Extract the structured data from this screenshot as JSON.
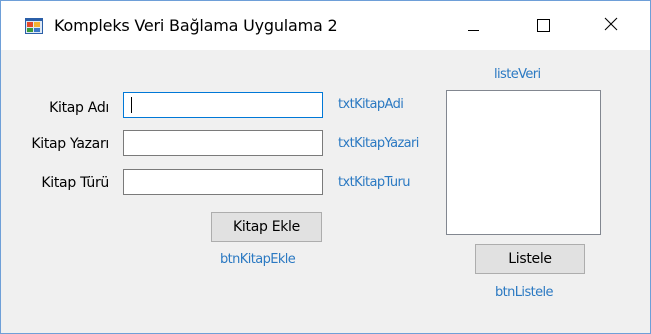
{
  "window": {
    "title": "Kompleks Veri Bağlama Uygulama 2",
    "app_icon": "winforms-app-icon",
    "controls": {
      "minimize": "minimize-icon",
      "maximize": "maximize-icon",
      "close": "close-icon"
    }
  },
  "form": {
    "kitap_adi": {
      "label": "Kitap Adı",
      "value": "",
      "control_name": "txtKitapAdi"
    },
    "kitap_yazari": {
      "label": "Kitap Yazarı",
      "value": "",
      "control_name": "txtKitapYazari"
    },
    "kitap_turu": {
      "label": "Kitap Türü",
      "value": "",
      "control_name": "txtKitapTuru"
    },
    "ekle_button": {
      "label": "Kitap Ekle",
      "control_name": "btnKitapEkle"
    }
  },
  "list": {
    "control_name": "listeVeri",
    "items": [],
    "listele_button": {
      "label": "Listele",
      "control_name": "btnListele"
    }
  },
  "colors": {
    "accent": "#0078d7",
    "control_name_text": "#2b79c2",
    "form_background": "#f0f0f0"
  }
}
